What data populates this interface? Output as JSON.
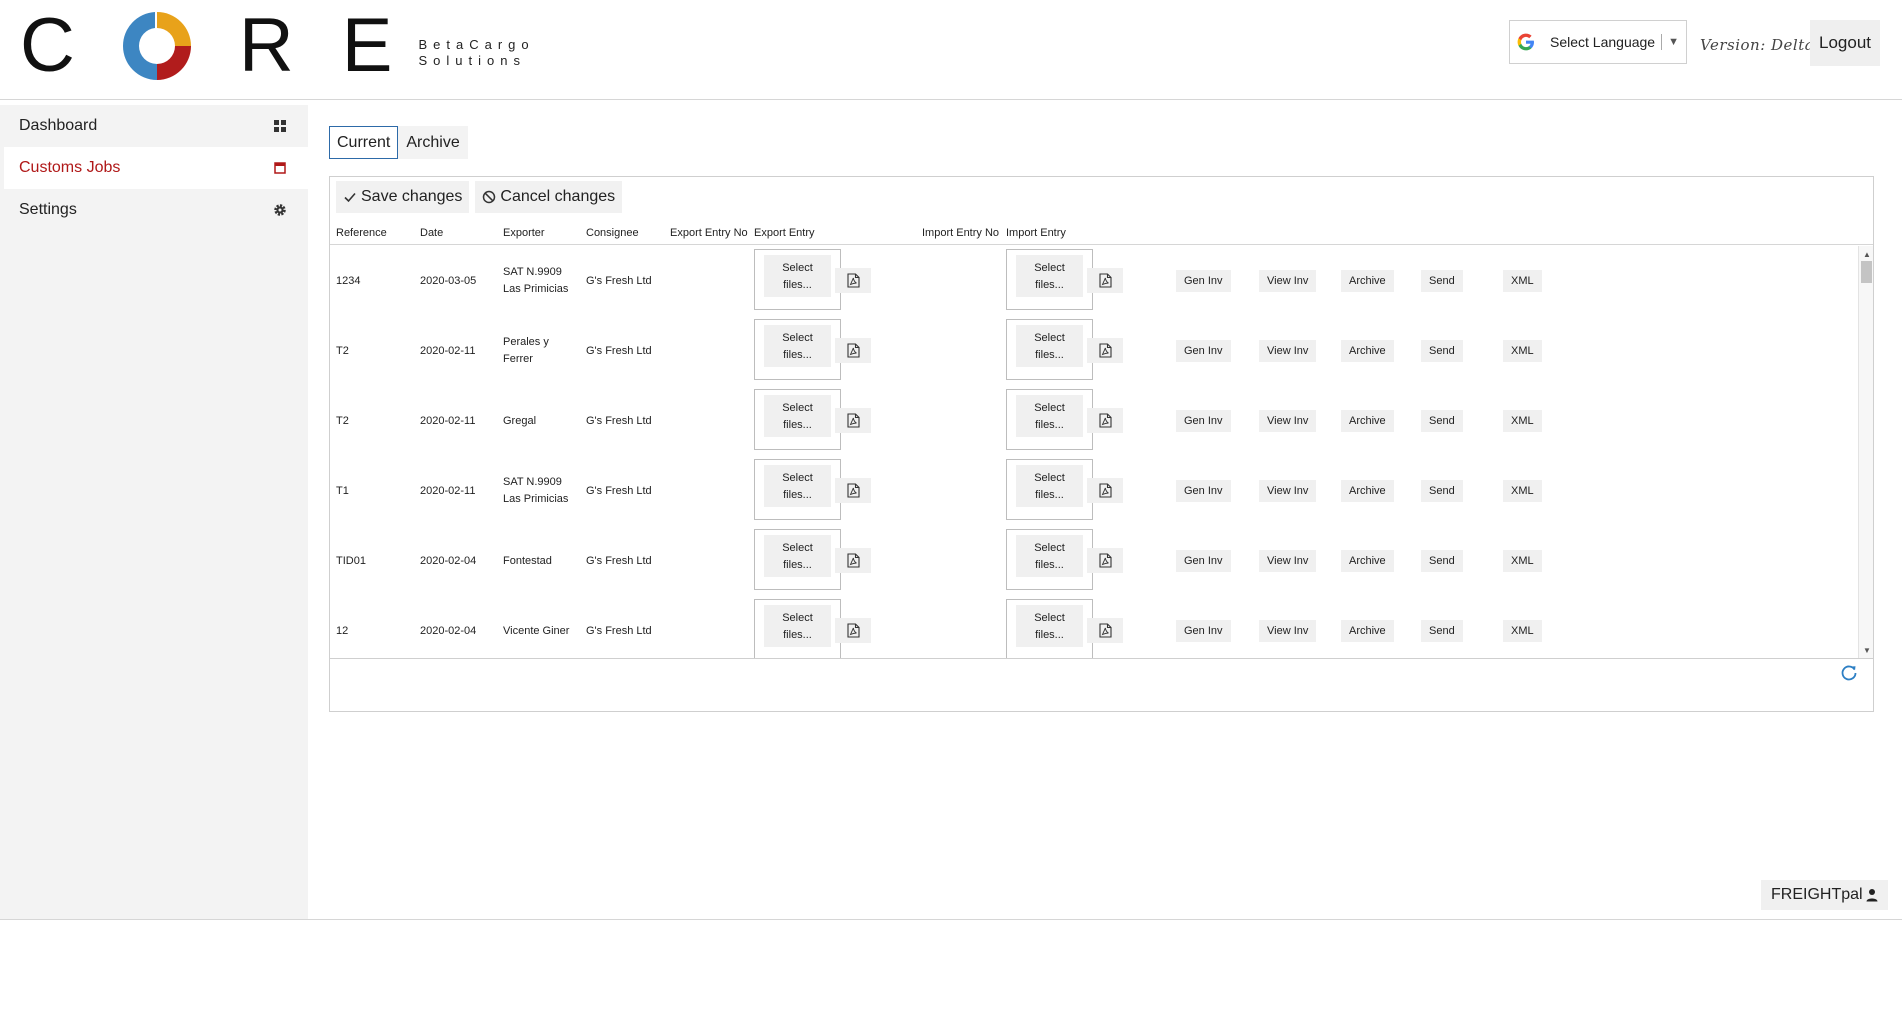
{
  "brand": {
    "letters": [
      "C",
      "R",
      "E"
    ],
    "sub_line1": "BetaCargo",
    "sub_line2": "Solutions",
    "ring_colors": [
      "#e8a21a",
      "#b11c1c",
      "#3d86c2"
    ]
  },
  "header": {
    "language_label": "Select Language",
    "version_text": "Version: Delta",
    "logout_label": "Logout"
  },
  "sidebar": {
    "items": [
      {
        "label": "Dashboard",
        "icon": "grid-icon",
        "active": false
      },
      {
        "label": "Customs Jobs",
        "icon": "calendar-icon",
        "active": true
      },
      {
        "label": "Settings",
        "icon": "gear-icon",
        "active": false
      }
    ]
  },
  "tabs": [
    "Current",
    "Archive"
  ],
  "toolbar": {
    "save_label": "Save changes",
    "cancel_label": "Cancel changes"
  },
  "table": {
    "columns": [
      "Reference",
      "Date",
      "Exporter",
      "Consignee",
      "Export Entry No",
      "Export Entry",
      "Import Entry No",
      "Import Entry"
    ],
    "select_files_label": "Select files...",
    "select_files_line1": "Select",
    "select_files_line2": "files...",
    "actions": [
      "Gen Inv",
      "View Inv",
      "Archive",
      "Send",
      "XML"
    ],
    "rows": [
      {
        "reference": "1234",
        "date": "2020-03-05",
        "exporter": "SAT N.9909 Las Primicias",
        "consignee": "G's Fresh Ltd"
      },
      {
        "reference": "T2",
        "date": "2020-02-11",
        "exporter": "Perales y Ferrer",
        "consignee": "G's Fresh Ltd"
      },
      {
        "reference": "T2",
        "date": "2020-02-11",
        "exporter": "Gregal",
        "consignee": "G's Fresh Ltd"
      },
      {
        "reference": "T1",
        "date": "2020-02-11",
        "exporter": "SAT N.9909 Las Primicias",
        "consignee": "G's Fresh Ltd"
      },
      {
        "reference": "TID01",
        "date": "2020-02-04",
        "exporter": "Fontestad",
        "consignee": "G's Fresh Ltd"
      },
      {
        "reference": "12",
        "date": "2020-02-04",
        "exporter": "Vicente Giner",
        "consignee": "G's Fresh Ltd"
      }
    ]
  },
  "footer": {
    "freightpal_label": "FREIGHTpal"
  },
  "colors": {
    "accent_red": "#b01818",
    "tab_border": "#2d6aa8",
    "refresh_blue": "#2d7fc4"
  }
}
